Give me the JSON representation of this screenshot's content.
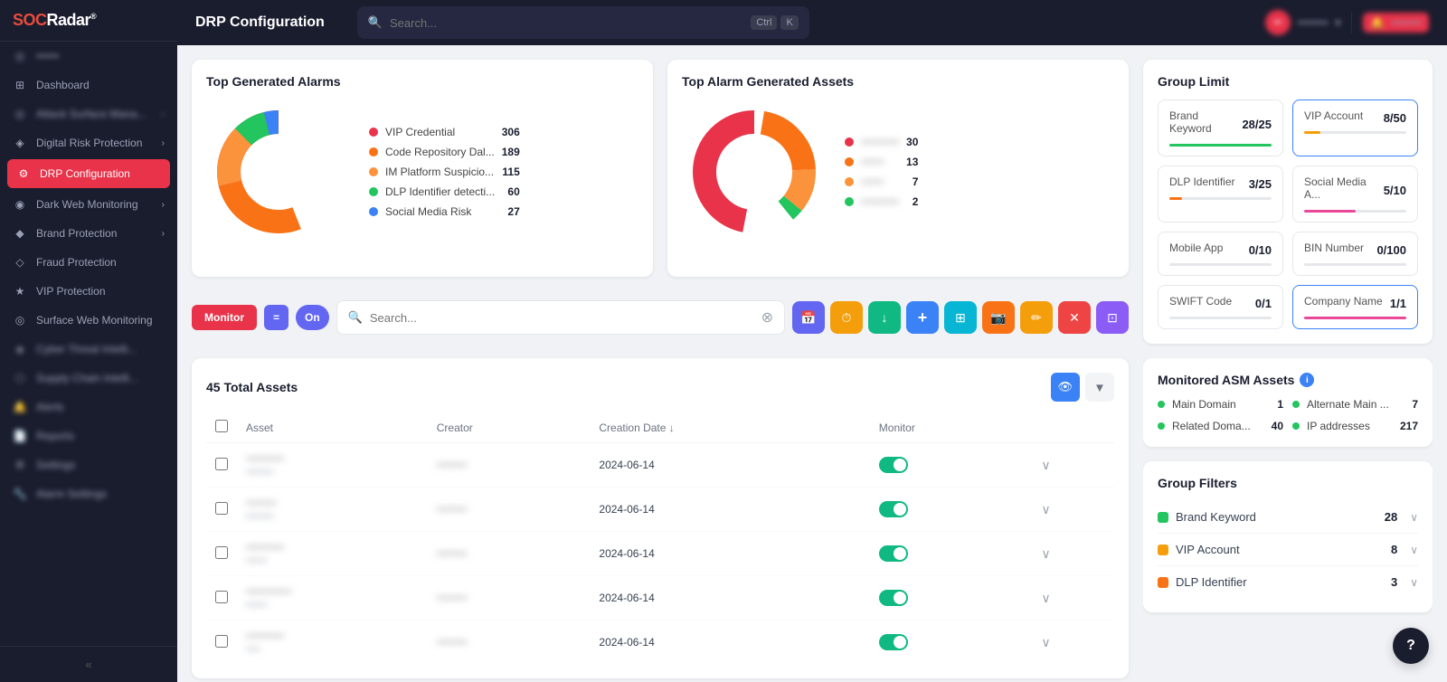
{
  "app": {
    "name": "SOCRadar",
    "page_title": "DRP Configuration"
  },
  "search": {
    "placeholder": "Search...",
    "shortcut_ctrl": "Ctrl",
    "shortcut_key": "K"
  },
  "sidebar": {
    "items": [
      {
        "id": "dashboard",
        "label": "Dashboard",
        "icon": "⊞",
        "active": false
      },
      {
        "id": "attack-surface",
        "label": "Attack Surface Management",
        "icon": "◎",
        "active": false,
        "has_chevron": true
      },
      {
        "id": "digital-risk",
        "label": "Digital Risk Protection",
        "icon": "◈",
        "active": false,
        "has_chevron": true
      },
      {
        "id": "drp-config",
        "label": "DRP Configuration",
        "icon": "⚙",
        "active": true
      },
      {
        "id": "dark-web",
        "label": "Dark Web Monitoring",
        "icon": "◉",
        "active": false,
        "has_chevron": true
      },
      {
        "id": "brand-protection",
        "label": "Brand Protection",
        "icon": "◆",
        "active": false,
        "has_chevron": true
      },
      {
        "id": "fraud-protection",
        "label": "Fraud Protection",
        "icon": "◇",
        "active": false
      },
      {
        "id": "vip-protection",
        "label": "VIP Protection",
        "icon": "★",
        "active": false
      },
      {
        "id": "surface-web",
        "label": "Surface Web Monitoring",
        "icon": "◎",
        "active": false
      },
      {
        "id": "cyber-threat",
        "label": "Cyber Threat Intelligence",
        "icon": "◈",
        "active": false
      },
      {
        "id": "supply-chain",
        "label": "Supply Chain Intelligence",
        "icon": "⬡",
        "active": false
      },
      {
        "id": "alerts",
        "label": "Alerts",
        "icon": "🔔",
        "active": false
      },
      {
        "id": "reports",
        "label": "Reports",
        "icon": "📄",
        "active": false
      },
      {
        "id": "settings",
        "label": "Settings",
        "icon": "⚙",
        "active": false
      },
      {
        "id": "alarm-settings",
        "label": "Alarm Settings",
        "icon": "🔧",
        "active": false
      }
    ]
  },
  "charts": {
    "top_alarms": {
      "title": "Top Generated Alarms",
      "items": [
        {
          "label": "VIP Credential",
          "value": 306,
          "color": "#e8334a"
        },
        {
          "label": "Code Repository Dat...",
          "value": 189,
          "color": "#f97316"
        },
        {
          "label": "IM Platform Suspicio...",
          "value": 115,
          "color": "#fb923c"
        },
        {
          "label": "DLP Identifier detecti...",
          "value": 60,
          "color": "#22c55e"
        },
        {
          "label": "Social Media Risk",
          "value": 27,
          "color": "#3b82f6"
        }
      ]
    },
    "top_assets": {
      "title": "Top Alarm Generated Assets",
      "items": [
        {
          "label": "••••••••••",
          "value": 30,
          "color": "#e8334a"
        },
        {
          "label": "••••••",
          "value": 13,
          "color": "#f97316"
        },
        {
          "label": "••••••",
          "value": 7,
          "color": "#fb923c"
        },
        {
          "label": "••••••••••",
          "value": 2,
          "color": "#22c55e"
        }
      ]
    }
  },
  "group_limit": {
    "title": "Group Limit",
    "items": [
      {
        "label": "Brand Keyword",
        "used": 28,
        "total": 25,
        "color": "#22c55e",
        "active": false
      },
      {
        "label": "VIP Account",
        "used": 8,
        "total": 50,
        "color": "#f59e0b",
        "active": true
      },
      {
        "label": "DLP Identifier",
        "used": 3,
        "total": 25,
        "color": "#f97316",
        "active": false
      },
      {
        "label": "Social Media A...",
        "used": 5,
        "total": 10,
        "color": "#ec4899",
        "active": false
      },
      {
        "label": "Mobile App",
        "used": 0,
        "total": 10,
        "color": "#6366f1",
        "active": false
      },
      {
        "label": "BIN Number",
        "used": 0,
        "total": 100,
        "color": "#6366f1",
        "active": false
      },
      {
        "label": "SWIFT Code",
        "used": 0,
        "total": 1,
        "color": "#e8334a",
        "active": false
      },
      {
        "label": "Company Name",
        "used": 1,
        "total": 1,
        "color": "#ec4899",
        "active": true
      }
    ]
  },
  "filter_bar": {
    "monitor_label": "Monitor",
    "eq_label": "=",
    "on_label": "On",
    "search_placeholder": "Search...",
    "actions": [
      {
        "icon": "📅",
        "class": "ib-purple",
        "name": "calendar-icon"
      },
      {
        "icon": "⏱",
        "class": "ib-orange",
        "name": "timer-icon"
      },
      {
        "icon": "↓",
        "class": "ib-green",
        "name": "download-icon"
      },
      {
        "icon": "+",
        "class": "ib-blue",
        "name": "add-icon"
      },
      {
        "icon": "⊞",
        "class": "ib-teal",
        "name": "grid-icon"
      },
      {
        "icon": "📷",
        "class": "ib-orange",
        "name": "camera-icon"
      },
      {
        "icon": "✏",
        "class": "ib-yellow",
        "name": "edit-icon"
      },
      {
        "icon": "✕",
        "class": "ib-red",
        "name": "delete-icon"
      },
      {
        "icon": "⊡",
        "class": "ib-purple",
        "name": "export-icon"
      }
    ]
  },
  "asset_table": {
    "total_label": "45 Total Assets",
    "columns": [
      {
        "id": "select",
        "label": ""
      },
      {
        "id": "asset",
        "label": "Asset"
      },
      {
        "id": "creator",
        "label": "Creator"
      },
      {
        "id": "creation_date",
        "label": "Creation Date"
      },
      {
        "id": "monitor",
        "label": "Monitor"
      },
      {
        "id": "expand",
        "label": ""
      }
    ],
    "rows": [
      {
        "asset": "••••••••••",
        "creator": "••••••••",
        "date": "2024-06-14",
        "monitor": true
      },
      {
        "asset": "••••••••",
        "creator": "••••••••",
        "date": "2024-06-14",
        "monitor": true
      },
      {
        "asset": "••••••••••",
        "creator": "••••••••",
        "date": "2024-06-14",
        "monitor": true
      },
      {
        "asset": "••••••••••••",
        "creator": "••••••••",
        "date": "2024-06-14",
        "monitor": true
      },
      {
        "asset": "••••••••••",
        "creator": "••••••••",
        "date": "2024-06-14",
        "monitor": true
      }
    ]
  },
  "asm": {
    "title": "Monitored ASM Assets",
    "items": [
      {
        "label": "Main Domain",
        "value": 1,
        "color": "#22c55e"
      },
      {
        "label": "Alternate Main ...",
        "value": 7,
        "color": "#22c55e"
      },
      {
        "label": "Related Doma...",
        "value": 40,
        "color": "#22c55e"
      },
      {
        "label": "IP addresses",
        "value": 217,
        "color": "#22c55e"
      }
    ]
  },
  "group_filters": {
    "title": "Group Filters",
    "items": [
      {
        "label": "Brand Keyword",
        "count": 28,
        "color": "#22c55e"
      },
      {
        "label": "VIP Account",
        "count": 8,
        "color": "#f59e0b"
      },
      {
        "label": "DLP Identifier",
        "count": 3,
        "color": "#f97316"
      }
    ]
  }
}
